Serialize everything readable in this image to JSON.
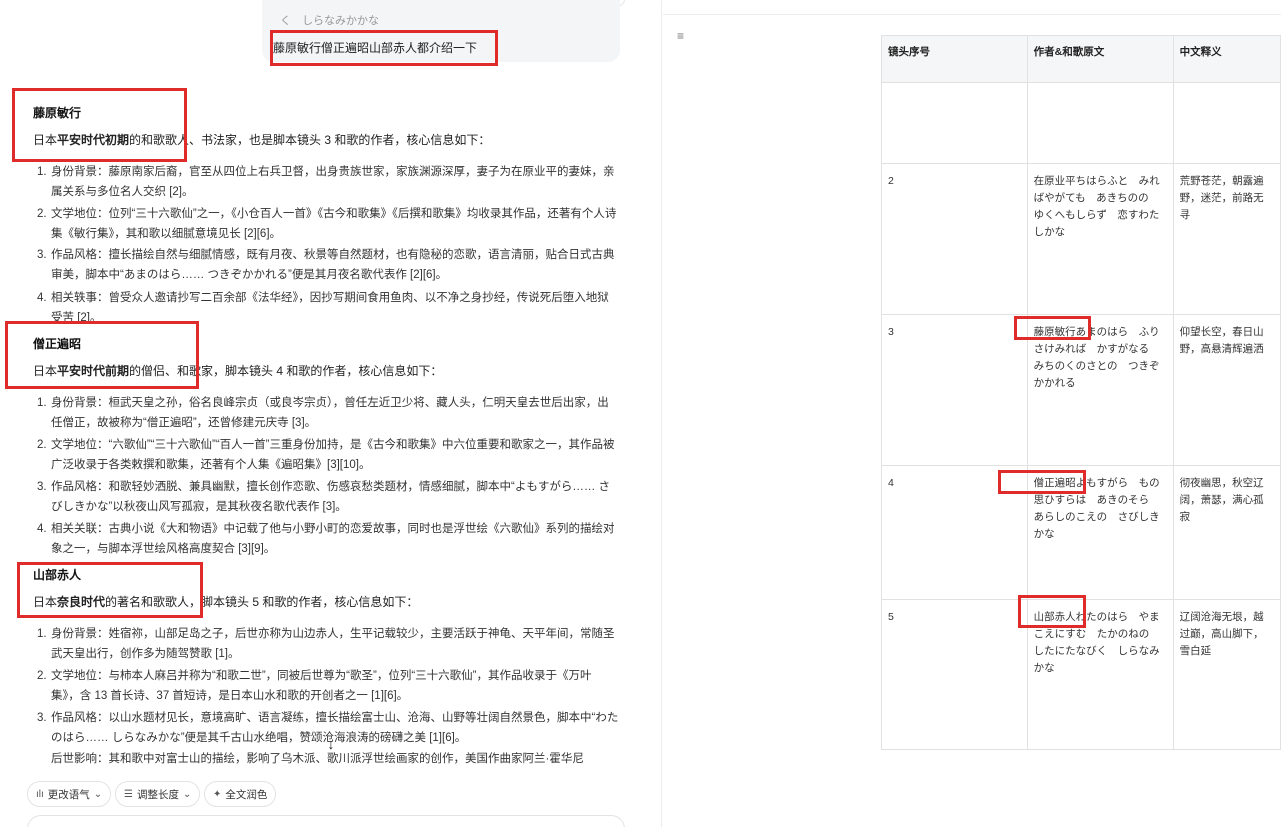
{
  "chat": {
    "quote_chevron": "く",
    "quote_text": "しらなみかかな",
    "user_question": "藤原敏行僧正遍昭山部赤人都介绍一下",
    "scroll_icon": "arrow-down-icon",
    "sections": [
      {
        "title": "藤原敏行",
        "intro_pre": "日本",
        "intro_bold": "平安时代初期",
        "intro_post": "的和歌歌人、书法家，也是脚本镜头 3 和歌的作者，核心信息如下：",
        "items": [
          "身份背景：藤原南家后裔，官至从四位上右兵卫督，出身贵族世家，家族渊源深厚，妻子为在原业平的妻妹，亲属关系与多位名人交织 [2]。",
          "文学地位：位列“三十六歌仙”之一，《小仓百人一首》《古今和歌集》《后撰和歌集》均收录其作品，还著有个人诗集《敏行集》，其和歌以细腻意境见长 [2][6]。",
          "作品风格：擅长描绘自然与细腻情感，既有月夜、秋景等自然题材，也有隐秘的恋歌，语言清丽，贴合日式古典审美，脚本中“あまのはら…… つきぞかかれる”便是其月夜名歌代表作 [2][6]。",
          "相关轶事：曾受众人邀请抄写二百余部《法华经》，因抄写期间食用鱼肉、以不净之身抄经，传说死后堕入地狱受苦 [2]。"
        ]
      },
      {
        "title": "僧正遍昭",
        "intro_pre": "日本",
        "intro_bold": "平安时代前期",
        "intro_post": "的僧侣、和歌家，脚本镜头 4 和歌的作者，核心信息如下：",
        "items": [
          "身份背景：桓武天皇之孙，俗名良峰宗贞（或良岑宗贞），曾任左近卫少将、藏人头，仁明天皇去世后出家，出任僧正，故被称为“僧正遍昭”，还曾修建元庆寺 [3]。",
          "文学地位：“六歌仙”“三十六歌仙”“百人一首”三重身份加持，是《古今和歌集》中六位重要和歌家之一，其作品被广泛收录于各类敕撰和歌集，还著有个人集《遍昭集》[3][10]。",
          "作品风格：和歌轻妙洒脱、兼具幽默，擅长创作恋歌、伤感哀愁类题材，情感细腻，脚本中“よもすがら…… さびしきかな”以秋夜山风写孤寂，是其秋夜名歌代表作 [3]。",
          "相关关联：古典小说《大和物语》中记载了他与小野小町的恋爱故事，同时也是浮世绘《六歌仙》系列的描绘对象之一，与脚本浮世绘风格高度契合 [3][9]。"
        ]
      },
      {
        "title": "山部赤人",
        "intro_pre": "日本",
        "intro_bold": "奈良时代",
        "intro_post": "的著名和歌歌人，脚本镜头 5 和歌的作者，核心信息如下：",
        "items": [
          "身份背景：姓宿祢，山部足岛之子，后世亦称为山边赤人，生平记载较少，主要活跃于神龟、天平年间，常随圣武天皇出行，创作多为随驾赞歌 [1]。",
          "文学地位：与柿本人麻吕并称为“和歌二世”，同被后世尊为“歌圣”，位列“三十六歌仙”，其作品收录于《万叶集》，含 13 首长诗、37 首短诗，是日本山水和歌的开创者之一 [1][6]。",
          "作品风格：以山水题材见长，意境高旷、语言凝练，擅长描绘富士山、沧海、山野等壮阔自然景色，脚本中“わたのはら…… しらなみかな”便是其千古山水绝唱，赞颂沧海浪涛的磅礴之美 [1][6]。",
          "后世影响：其和歌中对富士山的描绘，影响了乌木派、歌川派浮世绘画家的创作，美国作曲家阿兰·霍华尼"
        ]
      }
    ],
    "tools": [
      {
        "label": "更改语气",
        "icon": "waveform-icon",
        "arrow": "⌄"
      },
      {
        "label": "调整长度",
        "icon": "lines-icon",
        "arrow": "⌄"
      },
      {
        "label": "全文润色",
        "icon": "sparkle-icon",
        "arrow": ""
      }
    ]
  },
  "doc": {
    "menu_icon": "outline-icon",
    "table": {
      "headers": [
        "镜头序号",
        "作者&和歌原文",
        "中文释义"
      ],
      "rows": [
        {
          "no": "",
          "waka": "",
          "meaning": ""
        },
        {
          "no": "2",
          "waka": "在原业平ちはらふと　みればやがても　あきちのの　ゆくへもしらず　恋すわたしかな",
          "meaning": "荒野苍茫，朝露遍野，迷茫，前路无寻"
        },
        {
          "no": "3",
          "waka": "藤原敏行あまのはら　ふりさけみれば　かすがなる　みちのくのさとの　つきぞかかれる",
          "meaning": "仰望长空，春日山野，高悬清辉遍洒"
        },
        {
          "no": "4",
          "waka": "僧正遍昭よもすがら　もの思ひすらは　あきのそら　あらしのこえの　さびしきかな",
          "meaning": "彻夜幽思，秋空辽阔，萧瑟，满心孤寂"
        },
        {
          "no": "5",
          "waka": "山部赤人わたのはら　やまこえにすむ　たかのねの　したにたなびく　しらなみかな",
          "meaning": "辽阔沧海无垠，越过巅，高山脚下，雪白延"
        }
      ]
    }
  },
  "colors": {
    "highlight": "#e02b2b",
    "bubble": "#f4f5f7"
  }
}
